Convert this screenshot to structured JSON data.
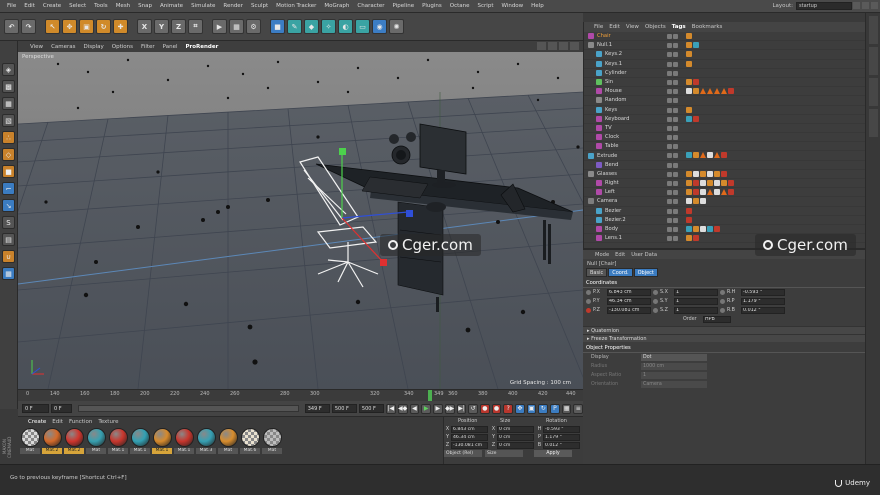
{
  "menubar": {
    "items": [
      "File",
      "Edit",
      "Create",
      "Select",
      "Tools",
      "Mesh",
      "Snap",
      "Animate",
      "Simulate",
      "Render",
      "Sculpt",
      "Motion Tracker",
      "MoGraph",
      "Character",
      "Pipeline",
      "Plugins",
      "Octane",
      "Script",
      "Window",
      "Help"
    ],
    "layout_label": "Layout:",
    "layout_value": "startup"
  },
  "toolbar": {
    "buttons": [
      "undo-icon",
      "redo-icon",
      "live-select-icon",
      "move-icon",
      "scale-icon",
      "rotate-icon",
      "recent-icon"
    ],
    "axes": [
      "X",
      "Y",
      "Z"
    ]
  },
  "viewport": {
    "menu": [
      "View",
      "Cameras",
      "Display",
      "Options",
      "Filter",
      "Panel",
      "ProRender"
    ],
    "label": "Perspective",
    "grid_spacing": "Grid Spacing : 100 cm"
  },
  "timeline": {
    "ticks": [
      "0",
      "140",
      "160",
      "180",
      "200",
      "220",
      "240",
      "260",
      "280",
      "300",
      "320",
      "340",
      "349",
      "360",
      "380",
      "400",
      "420",
      "440"
    ],
    "current_frame": "349 F"
  },
  "transport": {
    "start": "0 F",
    "field2": "0 F",
    "field3": "349 F",
    "end": "500 F",
    "field5": "500 F"
  },
  "materials": {
    "tabs": [
      "Create",
      "Edit",
      "Function",
      "Texture"
    ],
    "items": [
      {
        "label": "Mat",
        "color": "#d9d9d9",
        "checker": true
      },
      {
        "label": "Mat.2",
        "color": "#d46a2a"
      },
      {
        "label": "Mat.2",
        "color": "#d0352d"
      },
      {
        "label": "Mat",
        "color": "#37a0b0"
      },
      {
        "label": "Mat.1",
        "color": "#c9362d"
      },
      {
        "label": "Mat.1",
        "color": "#32a1b4"
      },
      {
        "label": "Mat.1",
        "color": "#d68a2c"
      },
      {
        "label": "Mat.1",
        "color": "#c8352c"
      },
      {
        "label": "Mat.3",
        "color": "#36a0b3"
      },
      {
        "label": "Mat",
        "color": "#d88d2d"
      },
      {
        "label": "Mat.6",
        "color": "#e9e1cf",
        "checker": true
      },
      {
        "label": "Mat",
        "color": "#bdbdbd",
        "checker": true
      }
    ]
  },
  "coordinates": {
    "headers": [
      "Position",
      "Size",
      "Rotation"
    ],
    "rows": [
      {
        "axis": "X",
        "pos": "6.843 cm",
        "size_axis": "X",
        "size": "0 cm",
        "rot_axis": "H",
        "rot": "-0.593 °"
      },
      {
        "axis": "Y",
        "pos": "46.34 cm",
        "size_axis": "Y",
        "size": "0 cm",
        "rot_axis": "P",
        "rot": "1.179 °"
      },
      {
        "axis": "Z",
        "pos": "-130.081 cm",
        "size_axis": "Z",
        "size": "0 cm",
        "rot_axis": "B",
        "rot": "0.012 °"
      }
    ],
    "mode": "Object (Rel)",
    "size_mode": "Size",
    "apply": "Apply"
  },
  "status": {
    "text": "Go to previous keyframe [Shortcut Ctrl+F]",
    "brand": "Udemy"
  },
  "object_manager": {
    "menu": [
      "File",
      "Edit",
      "View",
      "Objects",
      "Tags",
      "Bookmarks"
    ],
    "objects": [
      {
        "name": "Chair",
        "indent": 0,
        "icon": "#b04aa8",
        "selected": true,
        "tags": [
          "o"
        ]
      },
      {
        "name": "Null.1",
        "indent": 0,
        "icon": "#8a8a8a",
        "tags": [
          "o",
          "c"
        ]
      },
      {
        "name": "Keys.2",
        "indent": 1,
        "icon": "#4aa3c9",
        "tags": [
          "o"
        ]
      },
      {
        "name": "Keys.1",
        "indent": 1,
        "icon": "#4aa3c9",
        "tags": [
          "o"
        ]
      },
      {
        "name": "Cylinder",
        "indent": 1,
        "icon": "#4aa3c9",
        "tags": []
      },
      {
        "name": "Sin",
        "indent": 1,
        "icon": "#5fbf5f",
        "tags": [
          "o",
          "r"
        ]
      },
      {
        "name": "Mouse",
        "indent": 1,
        "icon": "#b04aa8",
        "tags": [
          "w",
          "o",
          "tri",
          "tri",
          "tri",
          "tri",
          "r"
        ]
      },
      {
        "name": "Random",
        "indent": 1,
        "icon": "#8a8a8a",
        "tags": []
      },
      {
        "name": "Keys",
        "indent": 1,
        "icon": "#4aa3c9",
        "tags": [
          "o"
        ]
      },
      {
        "name": "Keyboard",
        "indent": 1,
        "icon": "#b04aa8",
        "tags": [
          "c",
          "r"
        ]
      },
      {
        "name": "TV",
        "indent": 1,
        "icon": "#b04aa8",
        "tags": []
      },
      {
        "name": "Clock",
        "indent": 1,
        "icon": "#b04aa8",
        "tags": []
      },
      {
        "name": "Table",
        "indent": 1,
        "icon": "#b04aa8",
        "tags": []
      },
      {
        "name": "Extrude",
        "indent": 0,
        "icon": "#4aa3c9",
        "tags": [
          "c",
          "o",
          "tri",
          "w",
          "tri",
          "r"
        ]
      },
      {
        "name": "Bend",
        "indent": 1,
        "icon": "#7d5bc4",
        "tags": []
      },
      {
        "name": "Glasses",
        "indent": 0,
        "icon": "#8a8a8a",
        "tags": [
          "o",
          "w",
          "o",
          "w",
          "o",
          "r"
        ]
      },
      {
        "name": "Right",
        "indent": 1,
        "icon": "#b04aa8",
        "tags": [
          "o",
          "r",
          "w",
          "o",
          "w",
          "o",
          "r"
        ]
      },
      {
        "name": "Left",
        "indent": 1,
        "icon": "#b04aa8",
        "tags": [
          "o",
          "r",
          "w",
          "tri",
          "w",
          "tri",
          "r"
        ]
      },
      {
        "name": "Camera",
        "indent": 0,
        "icon": "#7d7d7d",
        "tags": [
          "w",
          "o",
          "w"
        ]
      },
      {
        "name": "Bezier",
        "indent": 1,
        "icon": "#4aa3c9",
        "tags": [
          "r"
        ]
      },
      {
        "name": "Bezier.2",
        "indent": 1,
        "icon": "#4aa3c9",
        "tags": [
          "r"
        ]
      },
      {
        "name": "Body",
        "indent": 1,
        "icon": "#b04aa8",
        "tags": [
          "c",
          "o",
          "w",
          "c",
          "r"
        ]
      },
      {
        "name": "Lens.1",
        "indent": 1,
        "icon": "#b04aa8",
        "tags": [
          "o",
          "r"
        ]
      }
    ]
  },
  "attribute_manager": {
    "menu": [
      "Mode",
      "Edit",
      "User Data"
    ],
    "title": "Null [Chair]",
    "tabs": [
      "Basic",
      "Coord.",
      "Object"
    ],
    "section": "Coordinates",
    "rows": [
      {
        "a1": "P.X",
        "v1": "6.843 cm",
        "a2": "S.X",
        "v2": "1",
        "a3": "R.H",
        "v3": "-0.593 °"
      },
      {
        "a1": "P.Y",
        "v1": "46.34 cm",
        "a2": "S.Y",
        "v2": "1",
        "a3": "R.P",
        "v3": "1.179 °"
      },
      {
        "a1": "P.Z",
        "v1": "-130.081 cm",
        "a2": "S.Z",
        "v2": "1",
        "a3": "R.B",
        "v3": "0.012 °"
      }
    ],
    "order_label": "Order",
    "order_value": "HPB",
    "collapsed": [
      "Quaternion",
      "Freeze Transformation"
    ],
    "props_title": "Object Properties",
    "props": [
      {
        "label": "Display",
        "value": "Dot",
        "dim": false
      },
      {
        "label": "Radius",
        "value": "1000 cm",
        "dim": true
      },
      {
        "label": "Aspect Ratio",
        "value": "1",
        "dim": true
      },
      {
        "label": "Orientation",
        "value": "Camera",
        "dim": true
      }
    ]
  },
  "watermark": "Cger.com"
}
